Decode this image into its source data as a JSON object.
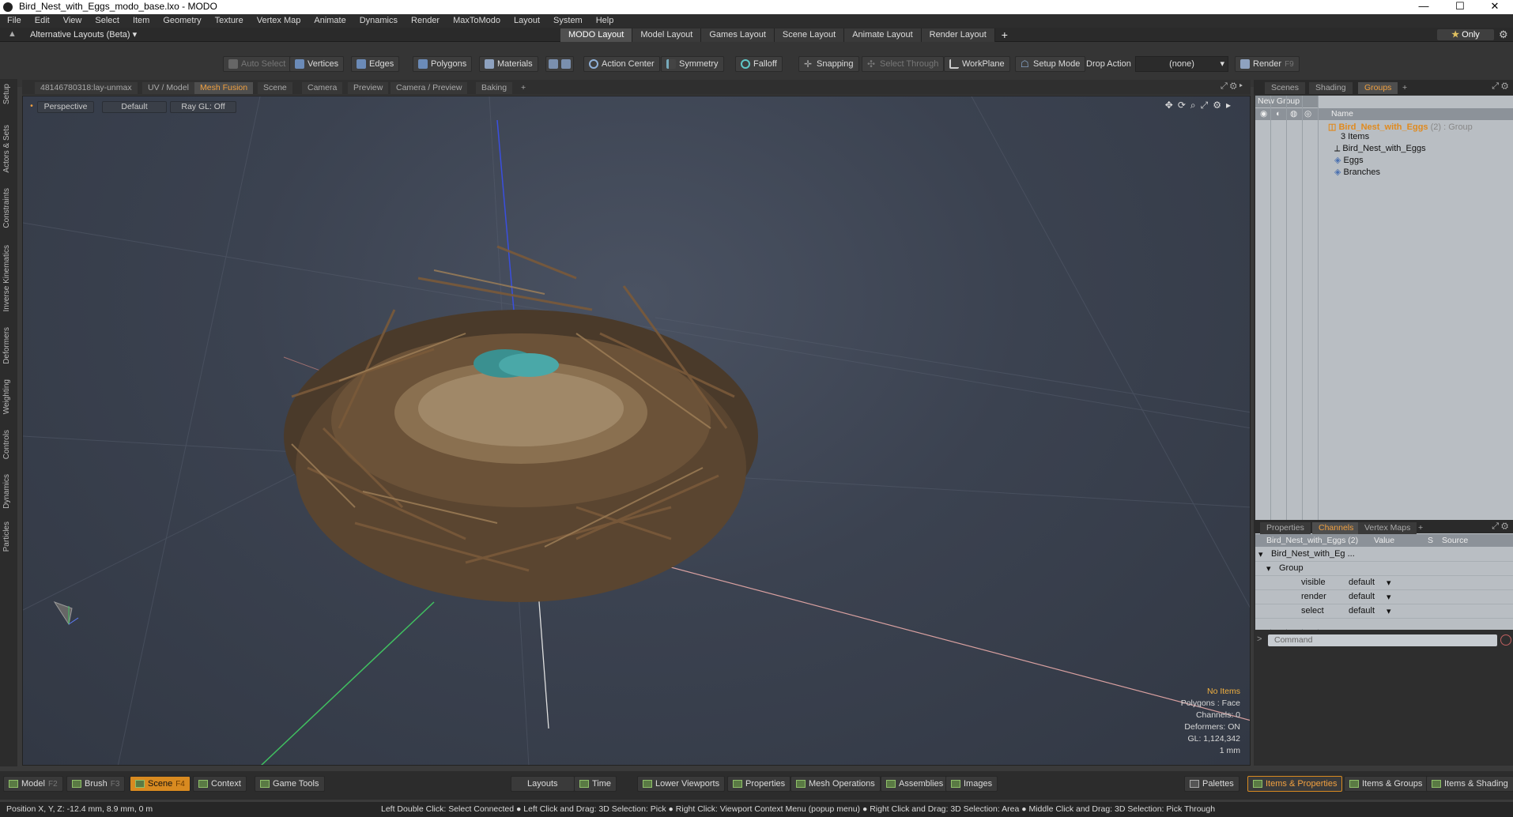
{
  "window": {
    "title": "Bird_Nest_with_Eggs_modo_base.lxo - MODO",
    "min": "—",
    "max": "☐",
    "close": "✕"
  },
  "menu": [
    "File",
    "Edit",
    "View",
    "Select",
    "Item",
    "Geometry",
    "Texture",
    "Vertex Map",
    "Animate",
    "Dynamics",
    "Render",
    "MaxToModo",
    "Layout",
    "System",
    "Help"
  ],
  "layoutbar": {
    "alt_layout": "Alternative Layouts (Beta) ▾",
    "tabs": [
      "MODO Layout",
      "Model Layout",
      "Games Layout",
      "Scene Layout",
      "Animate Layout",
      "Render Layout"
    ],
    "add": "+",
    "only_star": "★",
    "only": "Only"
  },
  "toolbar": {
    "auto_select": "Auto Select",
    "vertices": "Vertices",
    "edges": "Edges",
    "polygons": "Polygons",
    "materials": "Materials",
    "action_center": "Action Center",
    "symmetry": "Symmetry",
    "falloff": "Falloff",
    "snapping": "Snapping",
    "select_through": "Select Through",
    "workplane": "WorkPlane",
    "setup_mode": "Setup Mode",
    "drop_action": "Drop Action",
    "drop_value": "(none)",
    "render": "Render",
    "render_key": "F9"
  },
  "left_tabs": [
    "Setup",
    "Actors & Sets",
    "Constraints",
    "Inverse Kinematics",
    "Deformers",
    "Weighting",
    "Controls",
    "Dynamics",
    "Particles"
  ],
  "viewport_tabs": [
    "48146780318:lay-unmax",
    "UV / Model",
    "Mesh Fusion",
    "Scene",
    "Camera",
    "Preview",
    "Camera / Preview",
    "Baking",
    "+"
  ],
  "viewport": {
    "view": "Perspective",
    "shading": "Default",
    "raygl": "Ray GL: Off",
    "info": {
      "no_items": "No Items",
      "polygons": "Polygons : Face",
      "channels": "Channels: 0",
      "deformers": "Deformers: ON",
      "gl": "GL: 1,124,342",
      "unit": "1 mm"
    }
  },
  "right_tabs": [
    "Scenes",
    "Shading",
    "Groups",
    "+"
  ],
  "groups": {
    "new_group": "New Group",
    "name_col": "Name",
    "root": "Bird_Nest_with_Eggs",
    "root_suffix": "(2) : Group",
    "items_count": "3 Items",
    "children": [
      "Bird_Nest_with_Eggs",
      "Eggs",
      "Branches"
    ]
  },
  "props_tabs": [
    "Properties",
    "Channels",
    "Vertex Maps",
    "+"
  ],
  "channels": {
    "header_name": "Bird_Nest_with_Eggs (2)",
    "header_value": "Value",
    "header_s": "S",
    "header_source": "Source",
    "item": "Bird_Nest_with_Eg ...",
    "group": "Group",
    "rows": [
      {
        "name": "visible",
        "value": "default"
      },
      {
        "name": "render",
        "value": "default"
      },
      {
        "name": "select",
        "value": "default"
      }
    ],
    "command_placeholder": "Command"
  },
  "bottom": {
    "model": "Model",
    "model_key": "F2",
    "brush": "Brush",
    "brush_key": "F3",
    "scene": "Scene",
    "scene_key": "F4",
    "context": "Context",
    "game_tools": "Game Tools",
    "layouts": "Layouts",
    "time": "Time",
    "lower_viewports": "Lower Viewports",
    "properties": "Properties",
    "mesh_operations": "Mesh Operations",
    "assemblies": "Assemblies",
    "images": "Images",
    "palettes": "Palettes",
    "items_properties": "Items & Properties",
    "items_groups": "Items & Groups",
    "items_shading": "Items & Shading"
  },
  "status": {
    "position": "Position X, Y, Z:   -12.4 mm, 8.9 mm, 0 m",
    "hints": "Left Double Click: Select Connected ● Left Click and Drag: 3D Selection: Pick ● Right Click: Viewport Context Menu (popup menu) ● Right Click and Drag: 3D Selection: Area ● Middle Click and Drag: 3D Selection: Pick Through"
  }
}
